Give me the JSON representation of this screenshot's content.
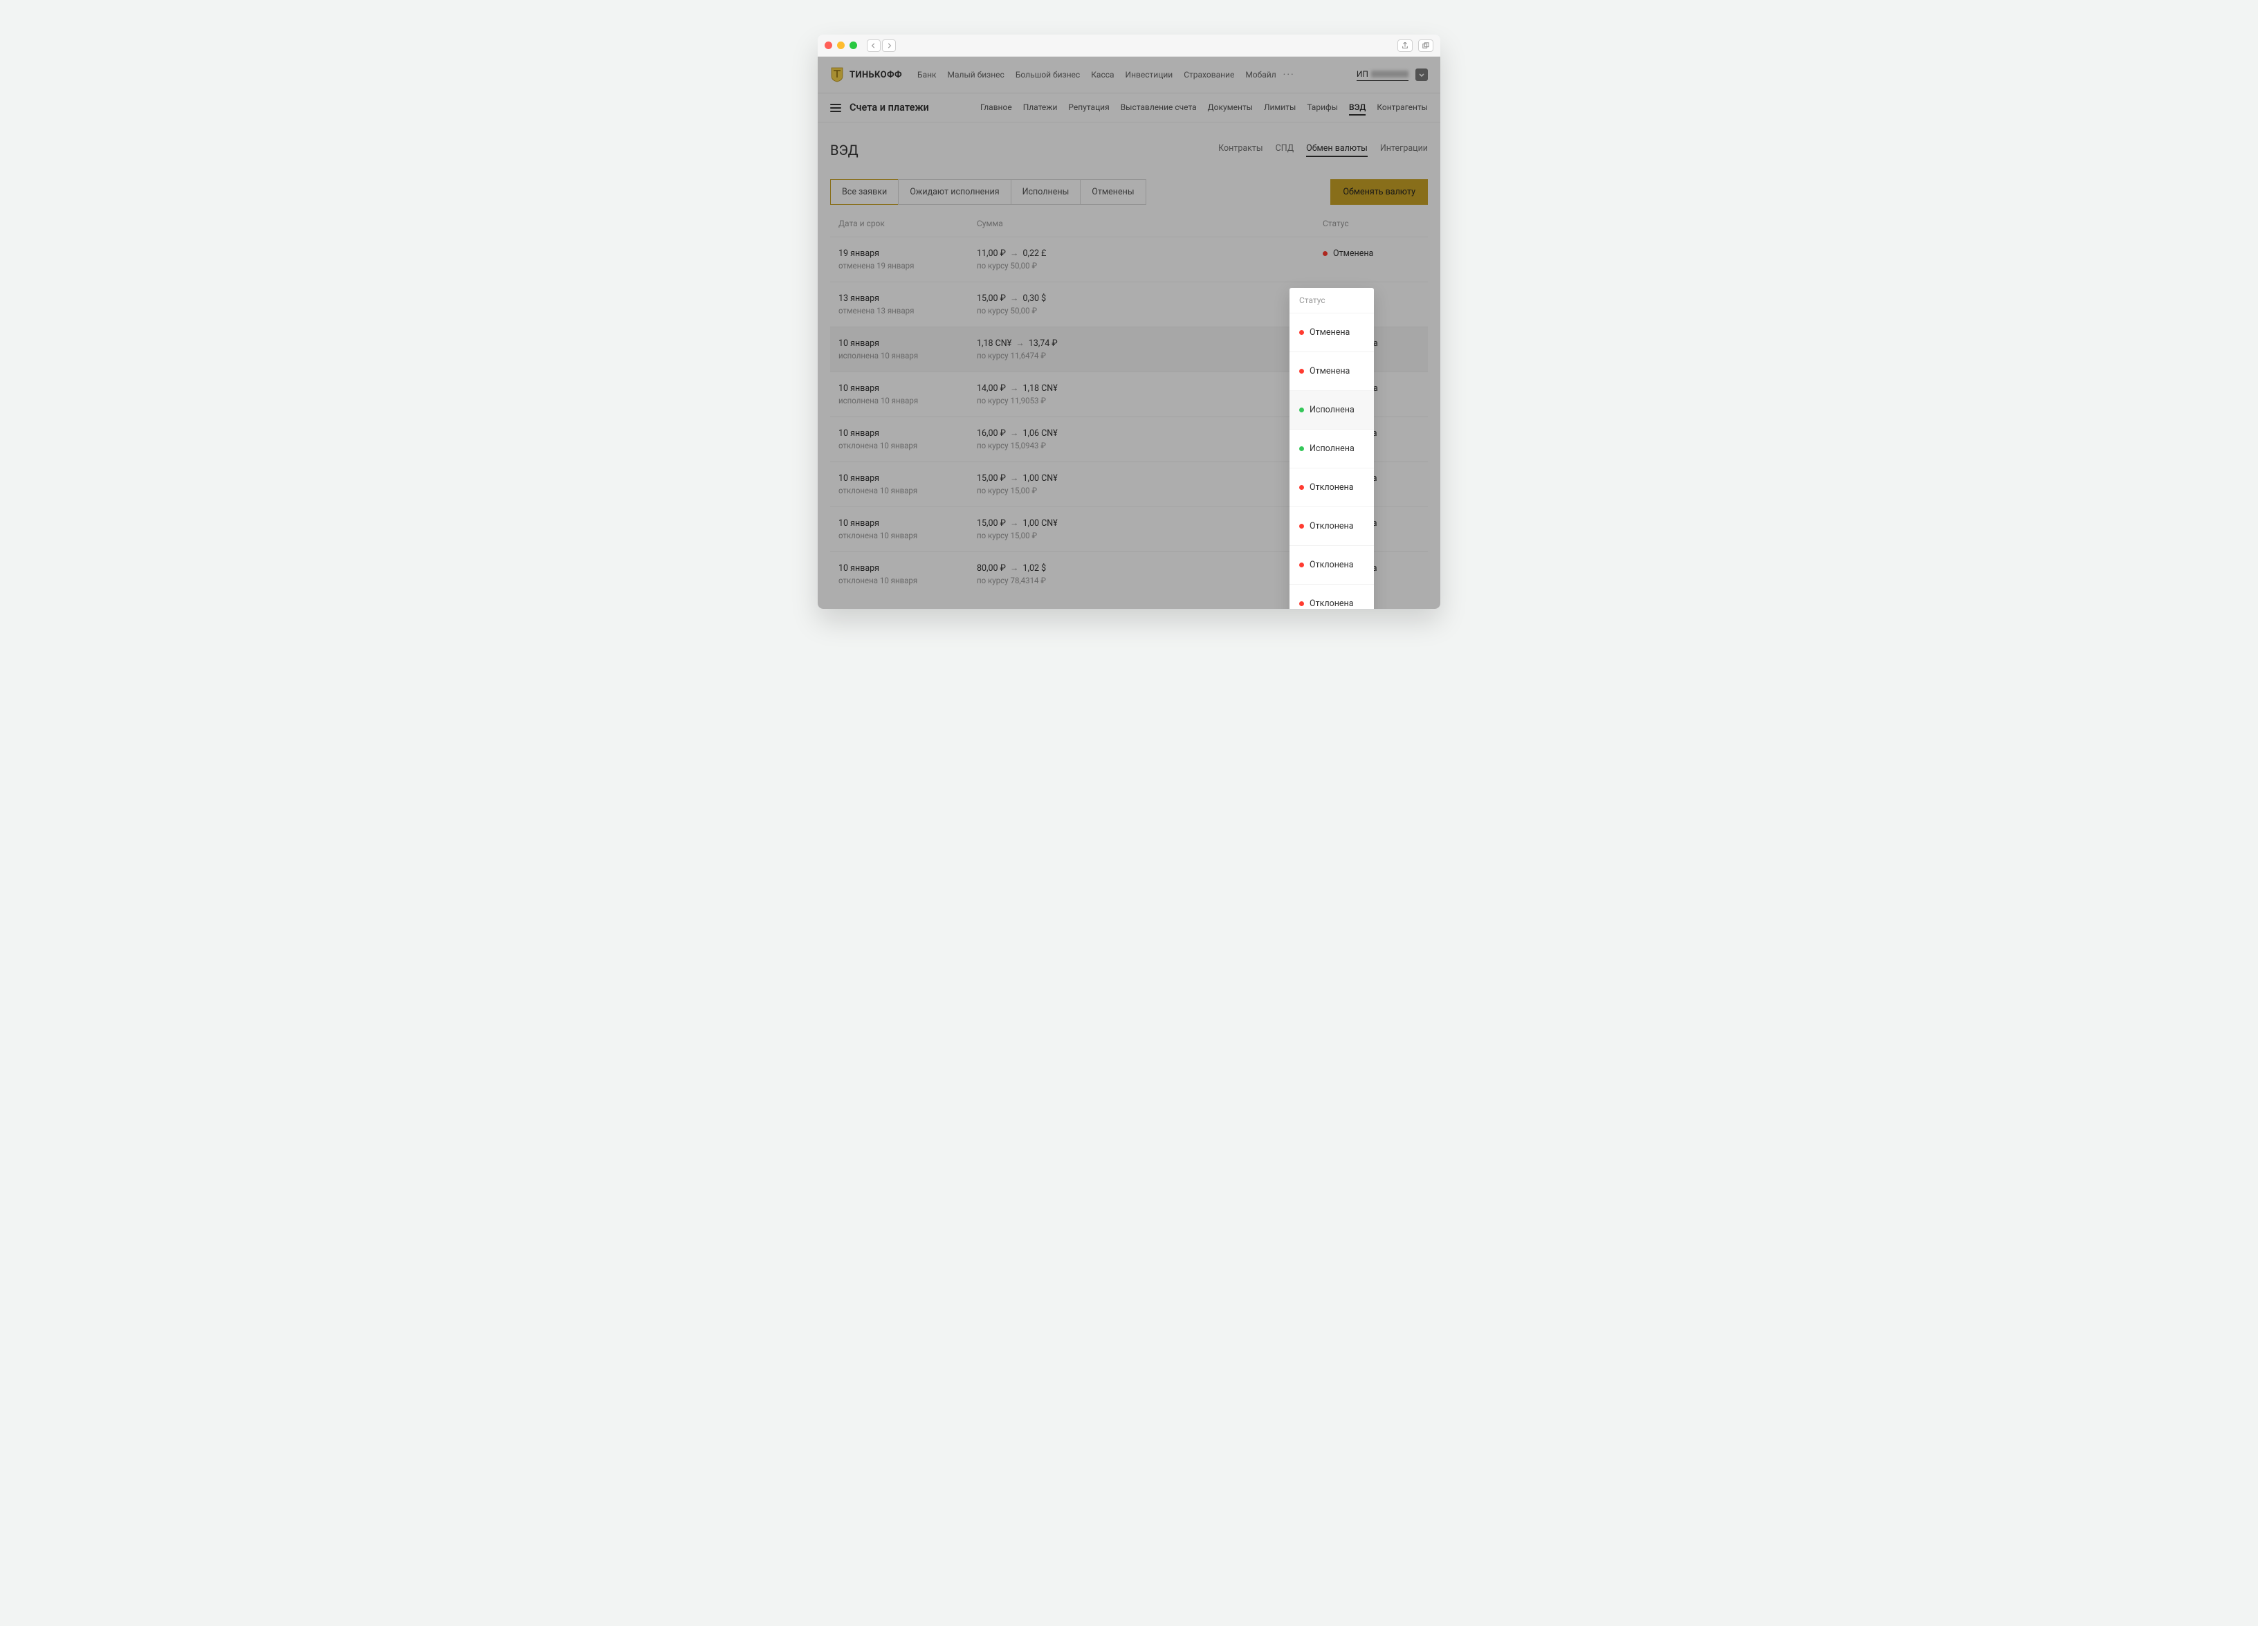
{
  "brand": "ТИНЬКОФФ",
  "topnav": [
    "Банк",
    "Малый бизнес",
    "Большой бизнес",
    "Касса",
    "Инвестиции",
    "Страхование",
    "Мобайл"
  ],
  "user_prefix": "ИП",
  "sub_title": "Счета и платежи",
  "subnav": {
    "items": [
      "Главное",
      "Платежи",
      "Репутация",
      "Выставление счета",
      "Документы",
      "Лимиты",
      "Тарифы",
      "ВЭД",
      "Контрагенты"
    ],
    "active": "ВЭД"
  },
  "page_title": "ВЭД",
  "page_tabs": {
    "items": [
      "Контракты",
      "СПД",
      "Обмен валюты",
      "Интеграции"
    ],
    "active": "Обмен валюты"
  },
  "filters": {
    "items": [
      "Все заявки",
      "Ожидают исполнения",
      "Исполнены",
      "Отменены"
    ],
    "active": "Все заявки"
  },
  "primary_action": "Обменять валюту",
  "columns": {
    "date": "Дата и срок",
    "sum": "Сумма",
    "status": "Статус"
  },
  "rows": [
    {
      "date": "19 января",
      "date_sub": "отменена 19 января",
      "from": "11,00 ₽",
      "to": "0,22 £",
      "rate": "по курсу 50,00 ₽",
      "status": "Отменена",
      "status_color": "red"
    },
    {
      "date": "13 января",
      "date_sub": "отменена 13 января",
      "from": "15,00 ₽",
      "to": "0,30 $",
      "rate": "по курсу 50,00 ₽",
      "status": "Отменена",
      "status_color": "red"
    },
    {
      "date": "10 января",
      "date_sub": "исполнена 10 января",
      "from": "1,18 CN¥",
      "to": "13,74 ₽",
      "rate": "по курсу 11,6474 ₽",
      "status": "Исполнена",
      "status_color": "green",
      "highlight": true
    },
    {
      "date": "10 января",
      "date_sub": "исполнена 10 января",
      "from": "14,00 ₽",
      "to": "1,18 CN¥",
      "rate": "по курсу 11,9053 ₽",
      "status": "Исполнена",
      "status_color": "green"
    },
    {
      "date": "10 января",
      "date_sub": "отклонена 10 января",
      "from": "16,00 ₽",
      "to": "1,06 CN¥",
      "rate": "по курсу 15,0943 ₽",
      "status": "Отклонена",
      "status_color": "red"
    },
    {
      "date": "10 января",
      "date_sub": "отклонена 10 января",
      "from": "15,00 ₽",
      "to": "1,00 CN¥",
      "rate": "по курсу 15,00 ₽",
      "status": "Отклонена",
      "status_color": "red"
    },
    {
      "date": "10 января",
      "date_sub": "отклонена 10 января",
      "from": "15,00 ₽",
      "to": "1,00 CN¥",
      "rate": "по курсу 15,00 ₽",
      "status": "Отклонена",
      "status_color": "red"
    },
    {
      "date": "10 января",
      "date_sub": "отклонена 10 января",
      "from": "80,00 ₽",
      "to": "1,02 $",
      "rate": "по курсу 78,4314 ₽",
      "status": "Отклонена",
      "status_color": "red"
    }
  ]
}
